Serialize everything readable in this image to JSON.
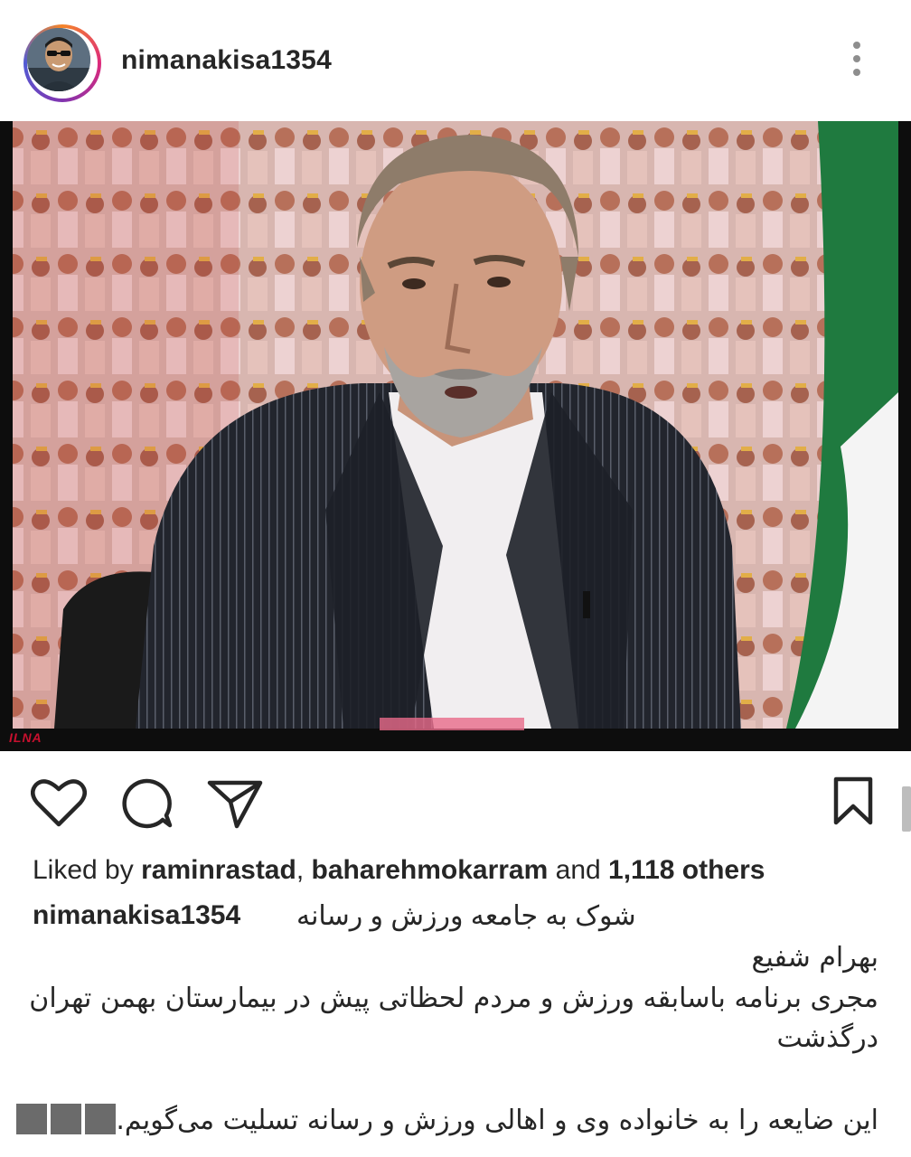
{
  "post": {
    "username": "nimanakisa1354",
    "avatar_icon": "profile-avatar",
    "more_icon": "more-vertical-icon",
    "photo_watermark": "ILNA"
  },
  "actions": {
    "like_icon": "heart-icon",
    "comment_icon": "comment-icon",
    "share_icon": "send-icon",
    "save_icon": "bookmark-icon"
  },
  "likes": {
    "prefix": "Liked by ",
    "user1": "raminrastad",
    "separator": ", ",
    "user2": "baharehmokarram",
    "and": " and ",
    "others": "1,118 others"
  },
  "caption": {
    "username": "nimanakisa1354",
    "line1": "شوک به جامعه ورزش و رسانه",
    "line2": "بهرام شفیع",
    "line3": "مجری برنامه باسابقه ورزش و مردم لحظاتی پیش در بیمارستان بهمن تهران",
    "line4": "درگذشت",
    "line5": "این ضایعه را به خانواده وی و اهالی ورزش و رسانه  تسلیت می‌گویم."
  },
  "colors": {
    "text": "#262626",
    "muted": "#8e8e8e",
    "ring_start": "#f58529",
    "ring_end": "#515bd4"
  }
}
